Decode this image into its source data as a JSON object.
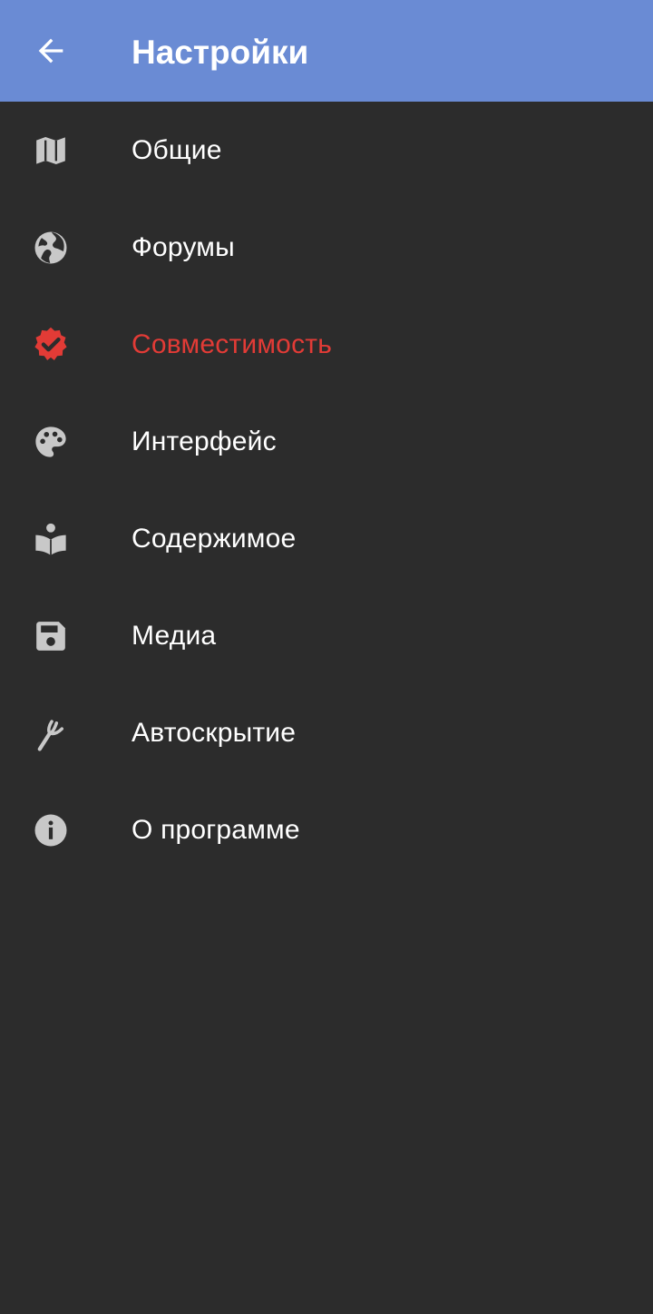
{
  "toolbar": {
    "title": "Настройки",
    "back_icon": "arrow-back-icon",
    "background_color": "#6a8bd4"
  },
  "menu": {
    "items": [
      {
        "label": "Общие",
        "icon": "map-icon",
        "active": false
      },
      {
        "label": "Форумы",
        "icon": "globe-icon",
        "active": false
      },
      {
        "label": "Совместимость",
        "icon": "verified-badge-icon",
        "active": true
      },
      {
        "label": "Интерфейс",
        "icon": "palette-icon",
        "active": false
      },
      {
        "label": "Содержимое",
        "icon": "reader-book-icon",
        "active": false
      },
      {
        "label": "Медиа",
        "icon": "floppy-disk-icon",
        "active": false
      },
      {
        "label": "Автоскрытие",
        "icon": "fork-icon",
        "active": false
      },
      {
        "label": "О программе",
        "icon": "info-icon",
        "active": false
      }
    ]
  },
  "colors": {
    "background": "#2c2c2c",
    "icon": "#c8c8c8",
    "active": "#e23b36",
    "text": "#ffffff"
  }
}
